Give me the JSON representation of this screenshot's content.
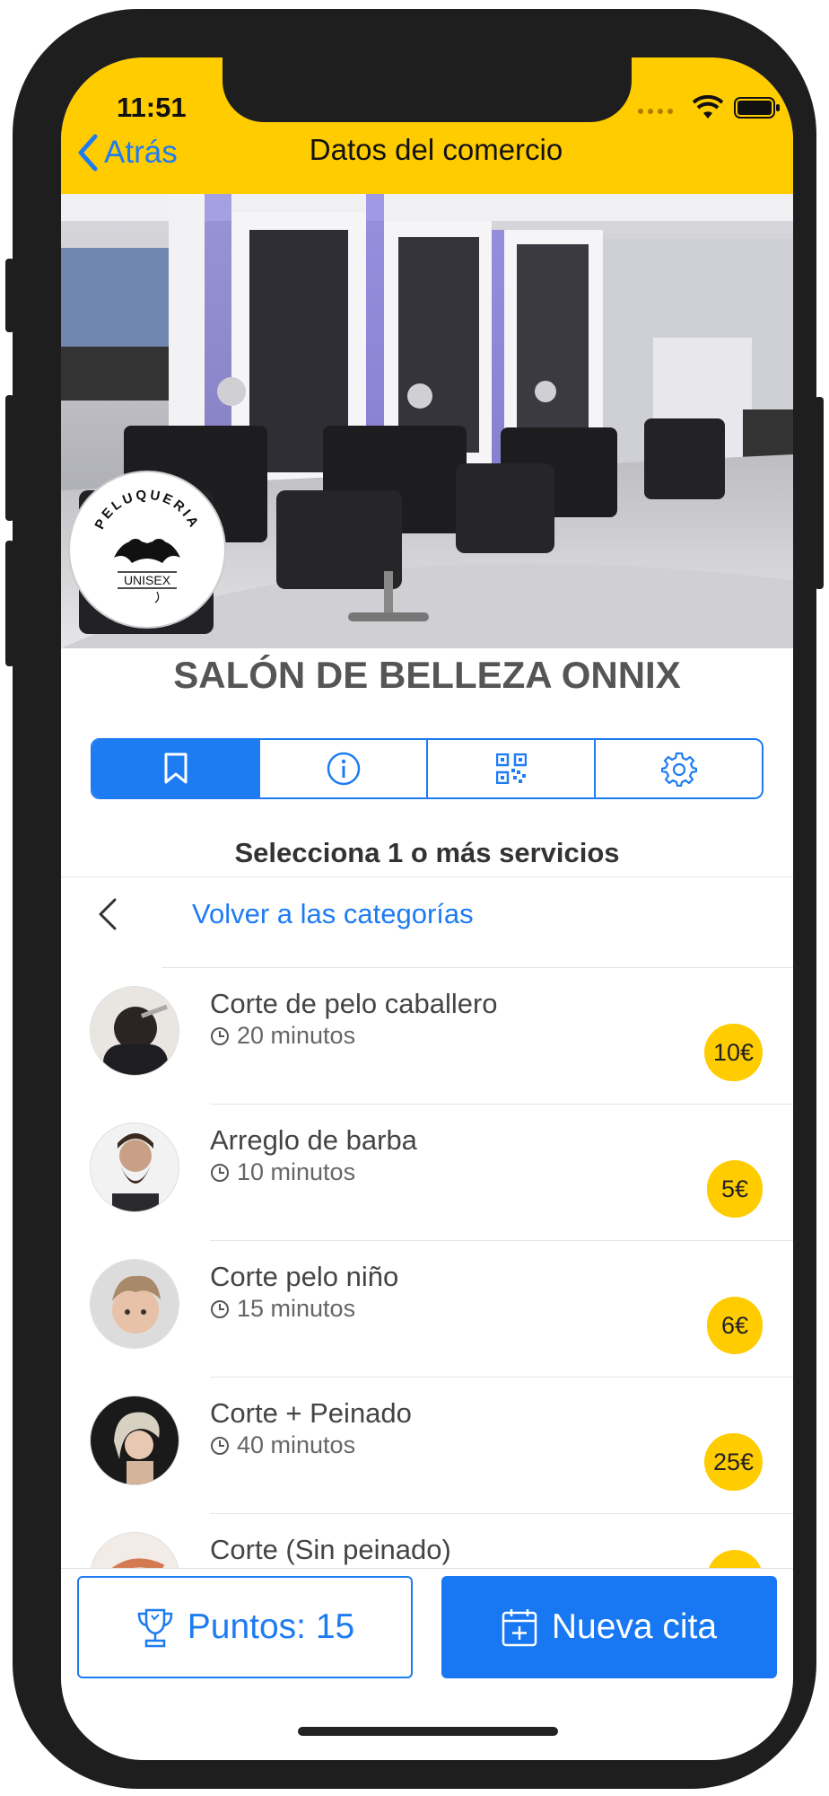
{
  "status_bar": {
    "time": "11:51"
  },
  "nav": {
    "back_label": "Atrás",
    "title": "Datos del comercio"
  },
  "store": {
    "name": "SALÓN DE BELLEZA ONNIX",
    "logo_top": "PELUQUERIA",
    "logo_bottom": "UNISEX"
  },
  "tabs": [
    {
      "icon": "bookmark-icon",
      "active": true
    },
    {
      "icon": "info-icon",
      "active": false
    },
    {
      "icon": "qr-code-icon",
      "active": false
    },
    {
      "icon": "gear-icon",
      "active": false
    }
  ],
  "services_section": {
    "prompt": "Selecciona 1 o más servicios",
    "back_to_categories": "Volver a las categorías"
  },
  "services": [
    {
      "name": "Corte de pelo caballero",
      "duration": "20 minutos",
      "price": "10€"
    },
    {
      "name": "Arreglo de barba",
      "duration": "10 minutos",
      "price": "5€"
    },
    {
      "name": "Corte pelo niño",
      "duration": "15 minutos",
      "price": "6€"
    },
    {
      "name": "Corte + Peinado",
      "duration": "40 minutos",
      "price": "25€"
    },
    {
      "name": "Corte (Sin peinado)",
      "duration": "",
      "price": ""
    }
  ],
  "bottom": {
    "points_label": "Puntos: 15",
    "new_appointment_label": "Nueva cita"
  },
  "colors": {
    "header_yellow": "#ffcc00",
    "accent_blue": "#1e7cf2"
  }
}
